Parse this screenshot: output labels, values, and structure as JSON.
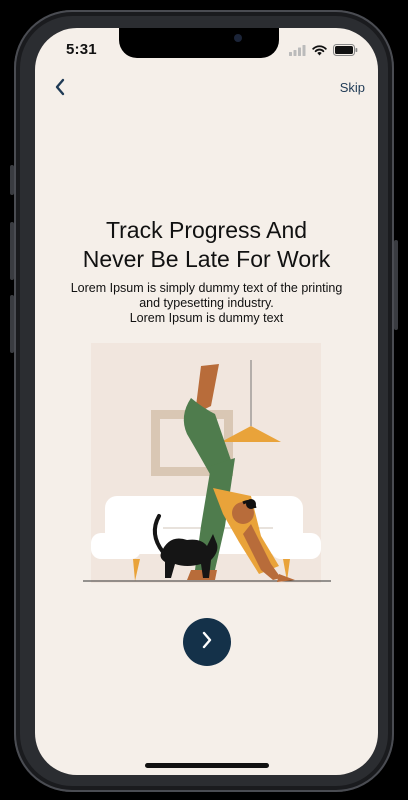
{
  "status": {
    "time": "5:31"
  },
  "nav": {
    "back_icon": "chevron-left-icon",
    "skip_label": "Skip"
  },
  "onboarding": {
    "title": "Track Progress And\nNever Be Late For Work",
    "description": "Lorem Ipsum is simply dummy text of the printing\nand typesetting industry.\nLorem Ipsum is dummy text",
    "next_icon": "chevron-right-icon"
  },
  "colors": {
    "background": "#f5efe9",
    "accent": "#143149",
    "nav_text": "#1f3a55"
  }
}
